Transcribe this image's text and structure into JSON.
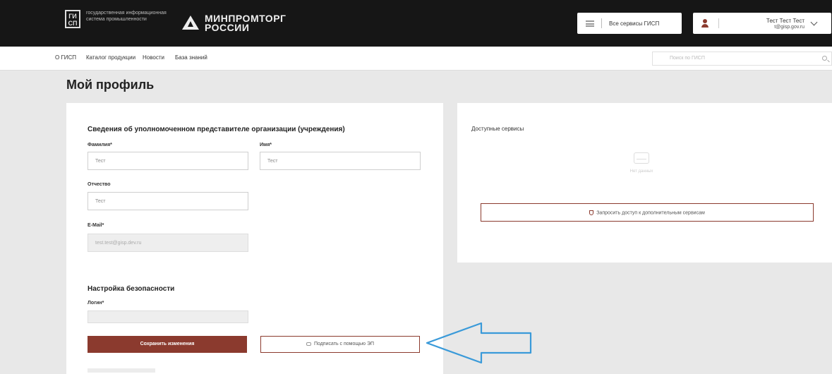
{
  "header": {
    "gisp_logo": "ГИ\nСП",
    "gisp_text": "государственная информационная система промышленности",
    "ministry_text": "МИНПРОМТОРГ\nРОССИИ",
    "services_label": "Все сервисы ГИСП",
    "user": {
      "name": "Тест Тест Тест",
      "email": "t@gisp.gov.ru"
    }
  },
  "nav": {
    "items": [
      "О ГИСП",
      "Каталог продукции",
      "Новости",
      "База знаний"
    ],
    "search_placeholder": "Поиск по ГИСП"
  },
  "page": {
    "title": "Мой профиль"
  },
  "profile": {
    "section_title": "Сведения об уполномоченном представителе организации (учреждения)",
    "surname_label": "Фамилия*",
    "surname_value": "Тест",
    "name_label": "Имя*",
    "name_value": "Тест",
    "patronymic_label": "Отчество",
    "patronymic_value": "Тест",
    "email_label": "E-Mail*",
    "email_value": "test.test@gisp.dev.ru",
    "security_title": "Настройка безопасности",
    "login_label": "Логин*",
    "login_value": "",
    "save_label": "Сохранить изменения",
    "eds_label": "Подписать с помощью ЭП"
  },
  "services": {
    "title": "Доступные сервисы",
    "empty_text": "Нет данных",
    "request_access_label": "Запросить доступ к дополнительным сервисам"
  },
  "colors": {
    "header_bg": "#161616",
    "accent": "#8b3a2e",
    "annotation_arrow": "#3a9ad9"
  }
}
